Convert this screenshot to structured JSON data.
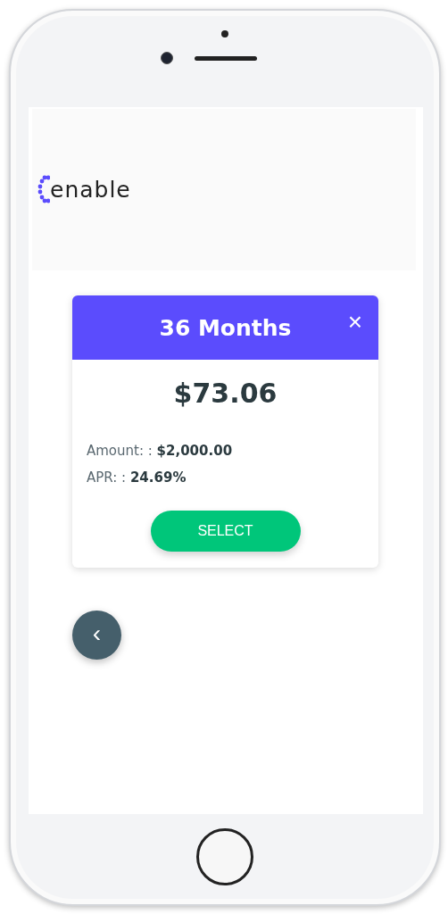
{
  "brand": {
    "name": "enable"
  },
  "plan_card": {
    "title": "36 Months",
    "close": "×",
    "payment": "$73.06",
    "details": [
      {
        "label": "Amount: :",
        "value": "$2,000.00"
      },
      {
        "label": "APR: :",
        "value": "24.69%"
      }
    ],
    "action": "SELECT"
  },
  "back_button": {
    "glyph": "‹"
  }
}
